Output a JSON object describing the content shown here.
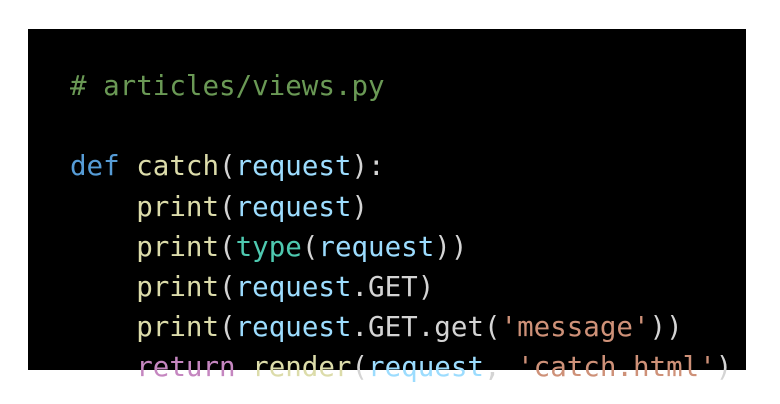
{
  "colors": {
    "background": "#000000",
    "comment": "#6a9955",
    "keyword": "#569cd6",
    "function": "#dcdcaa",
    "variable": "#9cdcfe",
    "punctuation": "#d4d4d4",
    "type": "#4ec9b0",
    "string": "#ce9178",
    "control": "#c586c0"
  },
  "code": {
    "lines": [
      [
        {
          "t": "# articles/views.py",
          "c": "comment"
        }
      ],
      [],
      [
        {
          "t": "def",
          "c": "keyword"
        },
        {
          "t": " ",
          "c": "punctuation"
        },
        {
          "t": "catch",
          "c": "function"
        },
        {
          "t": "(",
          "c": "punctuation"
        },
        {
          "t": "request",
          "c": "variable"
        },
        {
          "t": "):",
          "c": "punctuation"
        }
      ],
      [
        {
          "t": "    ",
          "c": "punctuation"
        },
        {
          "t": "print",
          "c": "function"
        },
        {
          "t": "(",
          "c": "punctuation"
        },
        {
          "t": "request",
          "c": "variable"
        },
        {
          "t": ")",
          "c": "punctuation"
        }
      ],
      [
        {
          "t": "    ",
          "c": "punctuation"
        },
        {
          "t": "print",
          "c": "function"
        },
        {
          "t": "(",
          "c": "punctuation"
        },
        {
          "t": "type",
          "c": "type"
        },
        {
          "t": "(",
          "c": "punctuation"
        },
        {
          "t": "request",
          "c": "variable"
        },
        {
          "t": "))",
          "c": "punctuation"
        }
      ],
      [
        {
          "t": "    ",
          "c": "punctuation"
        },
        {
          "t": "print",
          "c": "function"
        },
        {
          "t": "(",
          "c": "punctuation"
        },
        {
          "t": "request",
          "c": "variable"
        },
        {
          "t": ".GET)",
          "c": "punctuation"
        }
      ],
      [
        {
          "t": "    ",
          "c": "punctuation"
        },
        {
          "t": "print",
          "c": "function"
        },
        {
          "t": "(",
          "c": "punctuation"
        },
        {
          "t": "request",
          "c": "variable"
        },
        {
          "t": ".GET.get(",
          "c": "punctuation"
        },
        {
          "t": "'message'",
          "c": "string"
        },
        {
          "t": "))",
          "c": "punctuation"
        }
      ],
      [
        {
          "t": "    ",
          "c": "punctuation"
        },
        {
          "t": "return",
          "c": "control"
        },
        {
          "t": " ",
          "c": "punctuation"
        },
        {
          "t": "render",
          "c": "function"
        },
        {
          "t": "(",
          "c": "punctuation"
        },
        {
          "t": "request",
          "c": "variable"
        },
        {
          "t": ", ",
          "c": "punctuation"
        },
        {
          "t": "'catch.html'",
          "c": "string"
        },
        {
          "t": ")",
          "c": "punctuation"
        }
      ]
    ]
  }
}
